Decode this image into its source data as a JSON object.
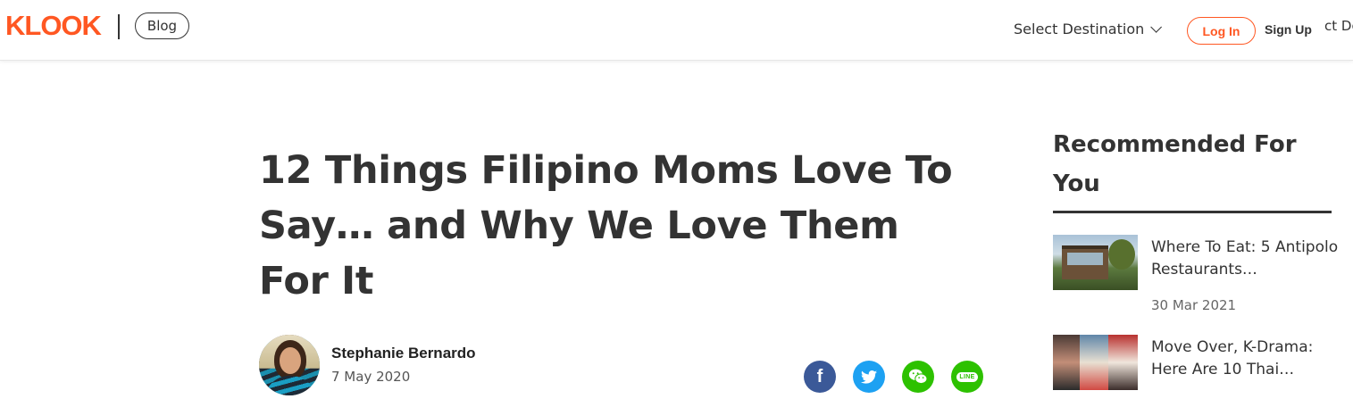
{
  "header": {
    "logo": "KLOOK",
    "blog_label": "Blog",
    "select_destination": "Select Destination",
    "login": "Log In",
    "signup": "Sign Up",
    "overflow_text": "ct De"
  },
  "article": {
    "title": "12 Things Filipino Moms Love To Say… and Why We Love Them For It",
    "author": "Stephanie Bernardo",
    "date": "7 May 2020",
    "share": {
      "facebook_glyph": "f",
      "line_glyph": "LINE"
    }
  },
  "sidebar": {
    "heading": "Recommended For You",
    "items": [
      {
        "title": "Where To Eat: 5 Antipolo Restaurants…",
        "date": "30 Mar 2021"
      },
      {
        "title": "Move Over, K-Drama: Here Are 10 Thai…"
      }
    ]
  },
  "colors": {
    "brand": "#ff5722",
    "facebook": "#3b5998",
    "twitter": "#1da1f2",
    "wechat": "#2dc100",
    "line": "#2dc100"
  },
  "icons": [
    "chevron-down-icon",
    "facebook-icon",
    "twitter-icon",
    "wechat-icon",
    "line-icon"
  ]
}
